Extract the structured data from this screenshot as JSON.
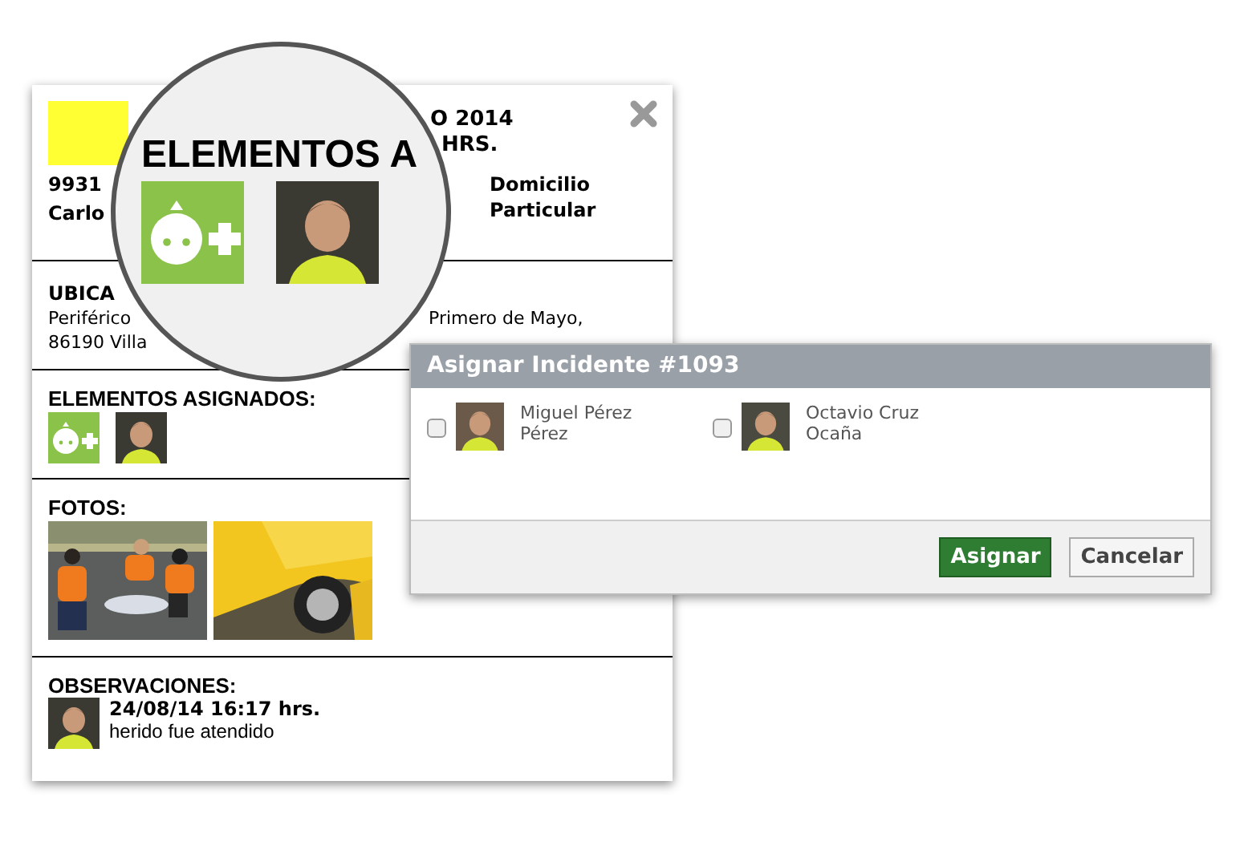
{
  "card": {
    "header": {
      "title_fragments": [
        "O 2014",
        "HRS."
      ],
      "id_fragment": "9931",
      "name_fragment": "Carlo",
      "place_type": "Domicilio Particular"
    },
    "location": {
      "heading_fragment": "UBICA",
      "line1_start": "Periférico",
      "line1_end": "Primero de Mayo,",
      "line2": "86190 Villa"
    },
    "assigned": {
      "heading": "ELEMENTOS ASIGNADOS:"
    },
    "photos": {
      "heading": "FOTOS:"
    },
    "observations": {
      "heading": "OBSERVACIONES:",
      "entries": [
        {
          "time": "24/08/14 16:17 hrs.",
          "text": "herido fue atendido"
        }
      ]
    }
  },
  "magnifier": {
    "heading": "ELEMENTOS A"
  },
  "dialog": {
    "title": "Asignar Incidente #1093",
    "people": [
      {
        "name": "Miguel Pérez Pérez",
        "checked": false
      },
      {
        "name": "Octavio Cruz Ocaña",
        "checked": false
      }
    ],
    "buttons": [
      {
        "label": "Asignar",
        "kind": "primary"
      },
      {
        "label": "Cancelar",
        "kind": "secondary"
      }
    ]
  }
}
